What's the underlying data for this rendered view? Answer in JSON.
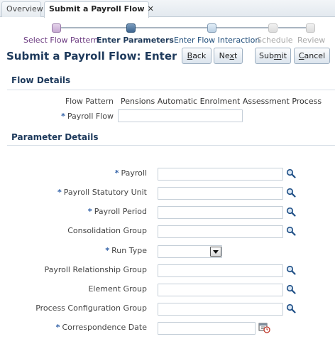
{
  "tabs": [
    {
      "label": "Overview",
      "active": false
    },
    {
      "label": "Submit a Payroll Flow",
      "active": true,
      "close_glyph": "✕"
    }
  ],
  "train": {
    "steps": [
      {
        "label": "Select Flow Pattern",
        "state": "visited"
      },
      {
        "label": "Enter Parameters",
        "state": "current"
      },
      {
        "label": "Enter Flow Interaction",
        "state": "next"
      },
      {
        "label": "Schedule",
        "state": "disabled"
      },
      {
        "label": "Review",
        "state": "disabled"
      }
    ]
  },
  "header": {
    "title": "Submit a Payroll Flow: Enter Par...",
    "buttons": {
      "back": {
        "pre": "",
        "mn": "B",
        "post": "ack"
      },
      "next": {
        "pre": "Ne",
        "mn": "x",
        "post": "t"
      },
      "submit": {
        "pre": "Sub",
        "mn": "m",
        "post": "it"
      },
      "cancel": {
        "pre": "",
        "mn": "C",
        "post": "ancel"
      }
    }
  },
  "flow_details": {
    "title": "Flow Details",
    "flow_pattern_label": "Flow Pattern",
    "flow_pattern_value": "Pensions Automatic Enrolment Assessment Process",
    "payroll_flow_label": "Payroll Flow",
    "payroll_flow_value": ""
  },
  "parameter_details": {
    "title": "Parameter Details",
    "fields": [
      {
        "label": "Payroll",
        "required": true,
        "type": "lov",
        "value": ""
      },
      {
        "label": "Payroll Statutory Unit",
        "required": true,
        "type": "lov",
        "value": ""
      },
      {
        "label": "Payroll Period",
        "required": true,
        "type": "lov",
        "value": ""
      },
      {
        "label": "Consolidation Group",
        "required": false,
        "type": "lov",
        "value": ""
      },
      {
        "label": "Run Type",
        "required": true,
        "type": "choice",
        "value": ""
      },
      {
        "label": "Payroll Relationship Group",
        "required": false,
        "type": "lov",
        "value": ""
      },
      {
        "label": "Element Group",
        "required": false,
        "type": "lov",
        "value": ""
      },
      {
        "label": "Process Configuration Group",
        "required": false,
        "type": "lov",
        "value": ""
      },
      {
        "label": "Correspondence Date",
        "required": true,
        "type": "date",
        "value": ""
      }
    ]
  },
  "required_marker": "*",
  "colors": {
    "accent": "#1e3a5c",
    "required": "#2f5fa6",
    "visited": "#6b3a80"
  }
}
